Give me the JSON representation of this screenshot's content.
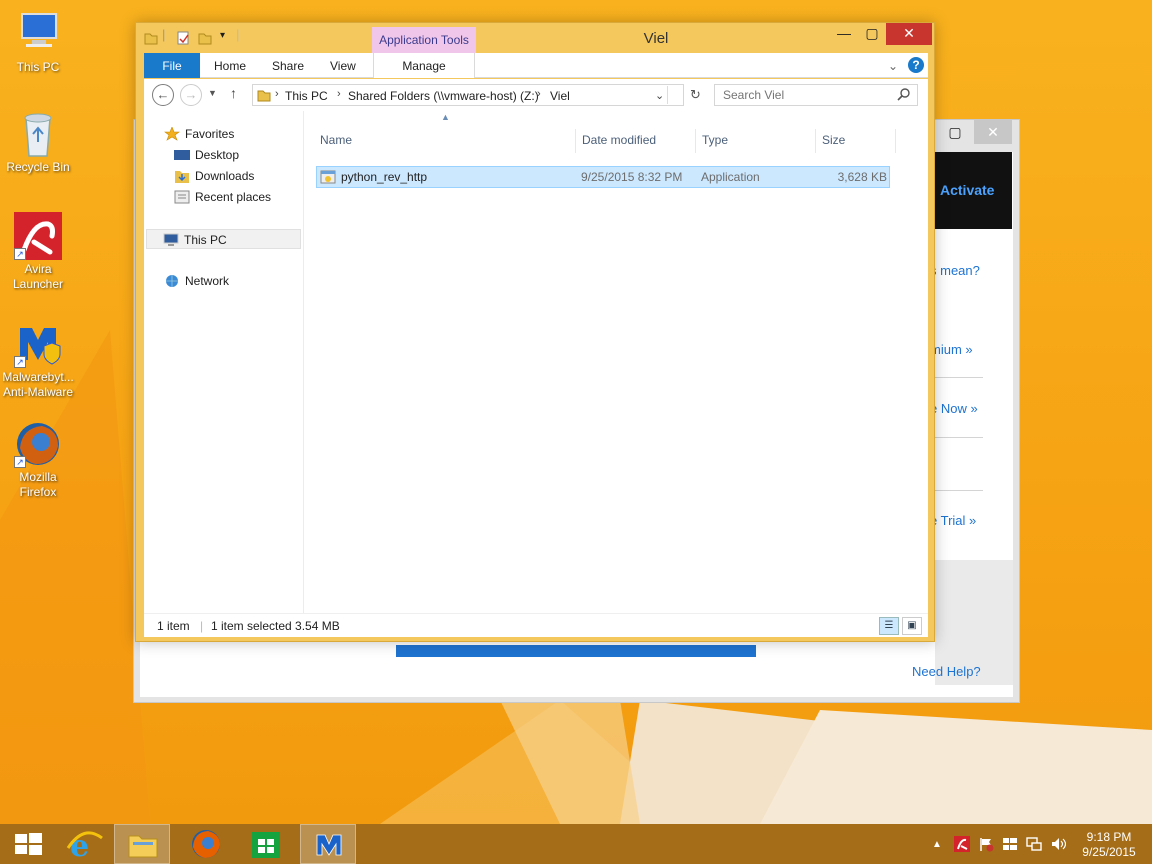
{
  "desktop": {
    "icons": [
      {
        "name": "This PC",
        "icon": "this-pc-icon"
      },
      {
        "name": "Recycle Bin",
        "icon": "recycle-bin-icon"
      },
      {
        "name": "Avira Launcher",
        "icon": "avira-icon"
      },
      {
        "name": "Malwarebyt... Anti-Malware",
        "icon": "malwarebytes-icon"
      },
      {
        "name": "Mozilla Firefox",
        "icon": "firefox-icon"
      }
    ]
  },
  "background_window": {
    "activate": "Activate",
    "links": [
      "s mean?",
      "mium »",
      "e Now »",
      "e Trial »"
    ],
    "need_help": "Need Help?"
  },
  "explorer": {
    "title": "Viel",
    "contextual_tab": "Application Tools",
    "tabs": [
      "File",
      "Home",
      "Share",
      "View",
      "Manage"
    ],
    "breadcrumb": [
      "This PC",
      "Shared Folders (\\\\vmware-host) (Z:)",
      "Viel"
    ],
    "search_placeholder": "Search Viel",
    "nav": {
      "favorites": "Favorites",
      "favorites_items": [
        "Desktop",
        "Downloads",
        "Recent places"
      ],
      "this_pc": "This PC",
      "network": "Network"
    },
    "columns": [
      "Name",
      "Date modified",
      "Type",
      "Size"
    ],
    "files": [
      {
        "name": "python_rev_http",
        "date": "9/25/2015 8:32 PM",
        "type": "Application",
        "size": "3,628 KB"
      }
    ],
    "status": {
      "count": "1 item",
      "selected": "1 item selected  3.54 MB"
    }
  },
  "taskbar": {
    "clock_time": "9:18 PM",
    "clock_date": "9/25/2015"
  },
  "colors": {
    "accent": "#1979ca",
    "window_border": "#f4c85c",
    "selection": "#cce8ff"
  }
}
